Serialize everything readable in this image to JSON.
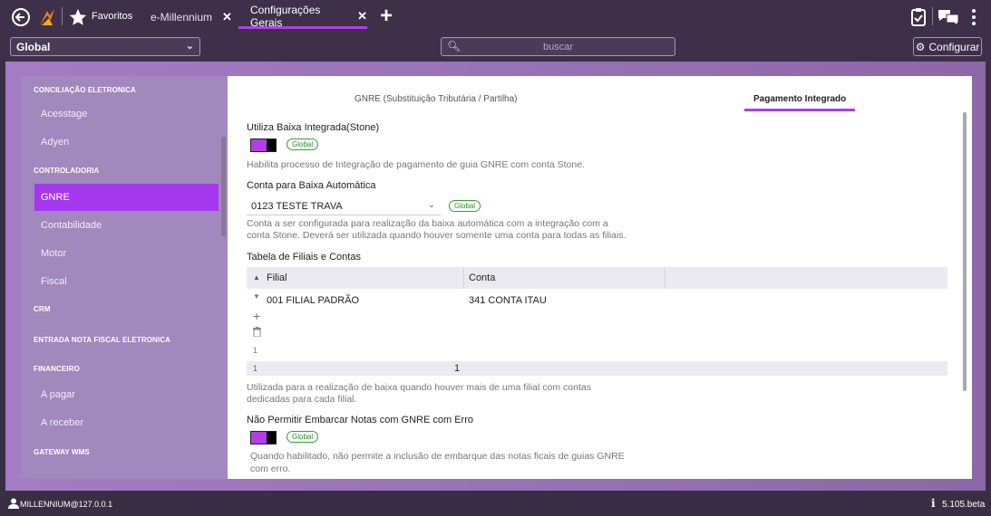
{
  "topbar": {
    "back_icon": "back-arrow-icon",
    "logo_icon": "millennium-logo-icon",
    "favorites_icon": "star-icon",
    "favorites_label": "Favoritos",
    "tabs": [
      {
        "label": "e-Millennium",
        "close": "✕"
      },
      {
        "label": "Configurações Gerais",
        "close": "✕"
      }
    ],
    "add_tab": "+",
    "right_icons": [
      "clipboard-icon",
      "chat-icon",
      "more-icon"
    ]
  },
  "toolbar": {
    "scope_value": "Global",
    "search_placeholder": "buscar",
    "configure_label": "Configurar"
  },
  "sidebar": {
    "items": [
      {
        "label": "CONCILIAÇÃO ELETRONICA",
        "type": "header"
      },
      {
        "label": "Acesstage",
        "type": "child"
      },
      {
        "label": "Adyen",
        "type": "child"
      },
      {
        "label": "CONTROLADORIA",
        "type": "header"
      },
      {
        "label": "GNRE",
        "type": "active"
      },
      {
        "label": "Contabilidade",
        "type": "child"
      },
      {
        "label": "Motor",
        "type": "child"
      },
      {
        "label": "Fiscal",
        "type": "child"
      },
      {
        "label": "CRM",
        "type": "header"
      },
      {
        "label": "ENTRADA NOTA FISCAL ELETRONICA",
        "type": "header"
      },
      {
        "label": "FINANCEIRO",
        "type": "header"
      },
      {
        "label": "A pagar",
        "type": "child"
      },
      {
        "label": "A receber",
        "type": "child"
      },
      {
        "label": "GATEWAY WMS",
        "type": "header"
      }
    ]
  },
  "content": {
    "tabs": [
      {
        "label": "GNRE (Substituição Tributária / Partilha)"
      },
      {
        "label": "Pagamento Integrado"
      }
    ],
    "section1": {
      "label": "Utiliza Baixa Integrada(Stone)",
      "badge": "Global",
      "description": "Habilita processo de Integração de pagamento de guia GNRE com conta Stone.",
      "toggle_on": true
    },
    "section2": {
      "label": "Conta para Baixa Automática",
      "value": "0123 TESTE TRAVA",
      "badge": "Global",
      "description_line1": "Conta a ser configurada para realização da baixa automática com a integração com a",
      "description_line2": "conta Stone. Deverá ser utilizada quando houver somente uma conta para todas as filiais."
    },
    "table": {
      "title": "Tabela de Filiais e Contas",
      "columns": [
        "Filial",
        "Conta"
      ],
      "rows": [
        {
          "filial": "001 FILIAL PADRÃO",
          "conta": "341 CONTA ITAU"
        }
      ],
      "row_number": "1",
      "footer_count_left": "1",
      "footer_count_right": "1",
      "description_line1": "Utilizada para a realização de baixa quando houver mais de uma filial com contas",
      "description_line2": "dedicadas para cada filial."
    },
    "section4": {
      "label": "Não Permitir Embarcar Notas com GNRE com Erro",
      "badge": "Global",
      "description_line1": "Quando habilitado, não permite a inclusão de embarque das notas ficais de guias GNRE",
      "description_line2": "com erro.",
      "toggle_on": true
    }
  },
  "status": {
    "user": "MILLENNIUM@127.0.0.1",
    "version": "5.105.beta"
  },
  "colors": {
    "accent": "#b13ee8",
    "topbar": "#3e3049",
    "sidebar": "#a188bd",
    "badge_green": "#2a8a2a"
  }
}
